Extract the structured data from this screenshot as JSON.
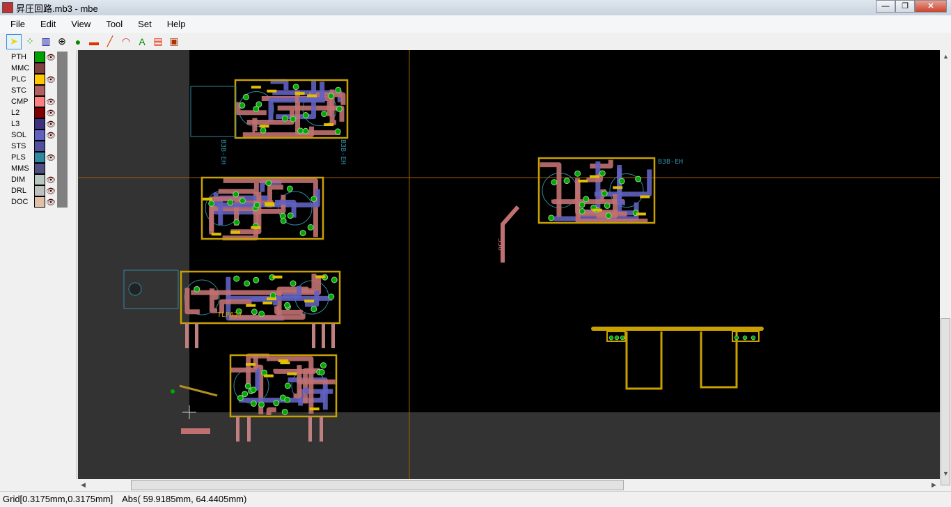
{
  "window": {
    "title": "昇圧回路.mb3 - mbe",
    "buttons": [
      "minimize",
      "maximize",
      "close"
    ]
  },
  "menu": [
    "File",
    "Edit",
    "View",
    "Tool",
    "Set",
    "Help"
  ],
  "toolbar": [
    {
      "icon": "pointer-icon",
      "glyph": "➤",
      "color": "#e8d800",
      "selected": true
    },
    {
      "icon": "component-icon",
      "glyph": "⁘",
      "color": "#00a000"
    },
    {
      "icon": "ruler-icon",
      "glyph": "▥",
      "color": "#0000a0"
    },
    {
      "icon": "circle-plus-icon",
      "glyph": "⊕",
      "color": "#000"
    },
    {
      "icon": "pad-icon",
      "glyph": "●",
      "color": "#008800"
    },
    {
      "icon": "rectangle-icon",
      "glyph": "▬",
      "color": "#dd3300"
    },
    {
      "icon": "line-icon",
      "glyph": "╱",
      "color": "#dd3300"
    },
    {
      "icon": "arc-icon",
      "glyph": "◠",
      "color": "#cc2244"
    },
    {
      "icon": "text-icon",
      "glyph": "A",
      "color": "#008800"
    },
    {
      "icon": "fill-icon",
      "glyph": "▤",
      "color": "#ee2200"
    },
    {
      "icon": "array-icon",
      "glyph": "▣",
      "color": "#aa3300"
    }
  ],
  "layers": [
    {
      "name": "PTH",
      "color": "#00a000",
      "visible": true
    },
    {
      "name": "MMC",
      "color": "#804040",
      "visible": false
    },
    {
      "name": "PLC",
      "color": "#ffc800",
      "visible": true
    },
    {
      "name": "STC",
      "color": "#b06060",
      "visible": false
    },
    {
      "name": "CMP",
      "color": "#ff8080",
      "visible": true
    },
    {
      "name": "L2",
      "color": "#800000",
      "visible": true
    },
    {
      "name": "L3",
      "color": "#403080",
      "visible": true
    },
    {
      "name": "SOL",
      "color": "#6060c0",
      "visible": true
    },
    {
      "name": "STS",
      "color": "#5050a0",
      "visible": false
    },
    {
      "name": "PLS",
      "color": "#3088a0",
      "visible": true
    },
    {
      "name": "MMS",
      "color": "#505080",
      "visible": false
    },
    {
      "name": "DIM",
      "color": "#b8c8c0",
      "visible": true
    },
    {
      "name": "DRL",
      "color": "#c0c0c0",
      "visible": true
    },
    {
      "name": "DOC",
      "color": "#e0c0a8",
      "visible": true
    }
  ],
  "eye_glyph": "👁",
  "canvas": {
    "labels": {
      "connector": "B3B-EH",
      "resistor": "330",
      "ic": "TLP627"
    }
  },
  "status": {
    "grid": "Grid[0.3175mm,0.3175mm]",
    "abs": "Abs( 59.9185mm, 64.4405mm)"
  }
}
